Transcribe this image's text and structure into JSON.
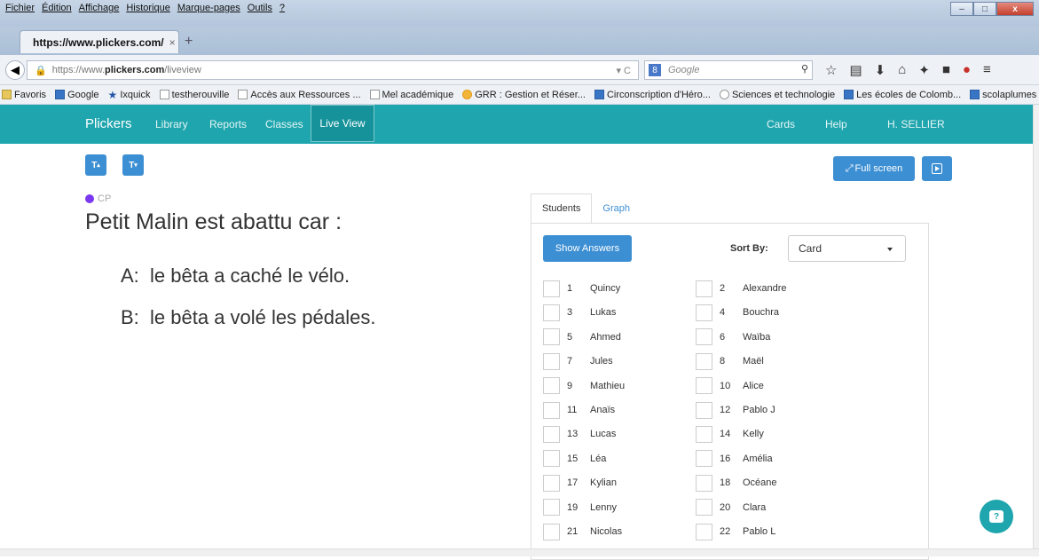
{
  "browser": {
    "menus": [
      "Fichier",
      "Édition",
      "Affichage",
      "Historique",
      "Marque-pages",
      "Outils",
      "?"
    ],
    "tab_title": "https://www.plickers.com/",
    "url_prefix": "https://www.",
    "url_domain": "plickers.com",
    "url_path": "/liveview",
    "search_placeholder": "Google",
    "bookmarks": [
      "Favoris",
      "Google",
      "Ixquick",
      "testherouville",
      "Accès aux Ressources ...",
      "Mel académique",
      "GRR : Gestion et Réser...",
      "Circonscription d'Héro...",
      "Sciences et technologie",
      "Les écoles de Colomb...",
      "scolaplumes - lire écrir..."
    ]
  },
  "nav": {
    "logo": "Plickers",
    "library": "Library",
    "reports": "Reports",
    "classes": "Classes",
    "live_view": "Live View",
    "cards": "Cards",
    "help": "Help",
    "user": "H. SELLIER"
  },
  "toolbar": {
    "text_up": "T",
    "text_down": "T",
    "fullscreen": "Full screen"
  },
  "question": {
    "class_name": "CP",
    "text": "Petit Malin est abattu car :",
    "answers": [
      {
        "letter": "A:",
        "text": "le bêta a caché le vélo."
      },
      {
        "letter": "B:",
        "text": "le bêta a volé les pédales."
      }
    ]
  },
  "panel": {
    "tab_students": "Students",
    "tab_graph": "Graph",
    "show_answers": "Show Answers",
    "sort_by_label": "Sort By:",
    "sort_value": "Card",
    "students": [
      {
        "num": "1",
        "name": "Quincy"
      },
      {
        "num": "2",
        "name": "Alexandre"
      },
      {
        "num": "3",
        "name": "Lukas"
      },
      {
        "num": "4",
        "name": "Bouchra"
      },
      {
        "num": "5",
        "name": "Ahmed"
      },
      {
        "num": "6",
        "name": "Waïba"
      },
      {
        "num": "7",
        "name": "Jules"
      },
      {
        "num": "8",
        "name": "Maël"
      },
      {
        "num": "9",
        "name": "Mathieu"
      },
      {
        "num": "10",
        "name": "Alice"
      },
      {
        "num": "11",
        "name": "Anaïs"
      },
      {
        "num": "12",
        "name": "Pablo J"
      },
      {
        "num": "13",
        "name": "Lucas"
      },
      {
        "num": "14",
        "name": "Kelly"
      },
      {
        "num": "15",
        "name": "Léa"
      },
      {
        "num": "16",
        "name": "Amélia"
      },
      {
        "num": "17",
        "name": "Kylian"
      },
      {
        "num": "18",
        "name": "Océane"
      },
      {
        "num": "19",
        "name": "Lenny"
      },
      {
        "num": "20",
        "name": "Clara"
      },
      {
        "num": "21",
        "name": "Nicolas"
      },
      {
        "num": "22",
        "name": "Pablo L"
      }
    ]
  },
  "colors": {
    "nav_bg": "#1fa5ad",
    "accent_blue": "#3d8fd3",
    "class_dot": "#7b38f0"
  }
}
